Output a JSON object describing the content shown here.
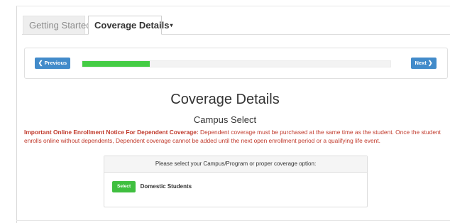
{
  "tabs": {
    "getting_started": "Getting Started",
    "coverage_details": "Coverage Details",
    "caret": "▾"
  },
  "nav": {
    "previous_label": "Previous",
    "next_label": "Next",
    "progress_fraction": 0.22
  },
  "content": {
    "title": "Coverage Details",
    "subtitle": "Campus Select",
    "notice_bold": "Important Online Enrollment Notice For Dependent Coverage:",
    "notice_text": " Dependent coverage must be purchased at the same time as the student. Once the student enrolls online without dependents, Dependent coverage cannot be added until the next open enrollment period or a qualifying life event."
  },
  "selection_panel": {
    "prompt": "Please select your Campus/Program or proper coverage option:",
    "options": [
      {
        "button_label": "Select",
        "label": "Domestic Students"
      }
    ]
  },
  "colors": {
    "primary_blue": "#428bca",
    "success_green": "#44cc44",
    "notice_red": "#c0392b"
  }
}
